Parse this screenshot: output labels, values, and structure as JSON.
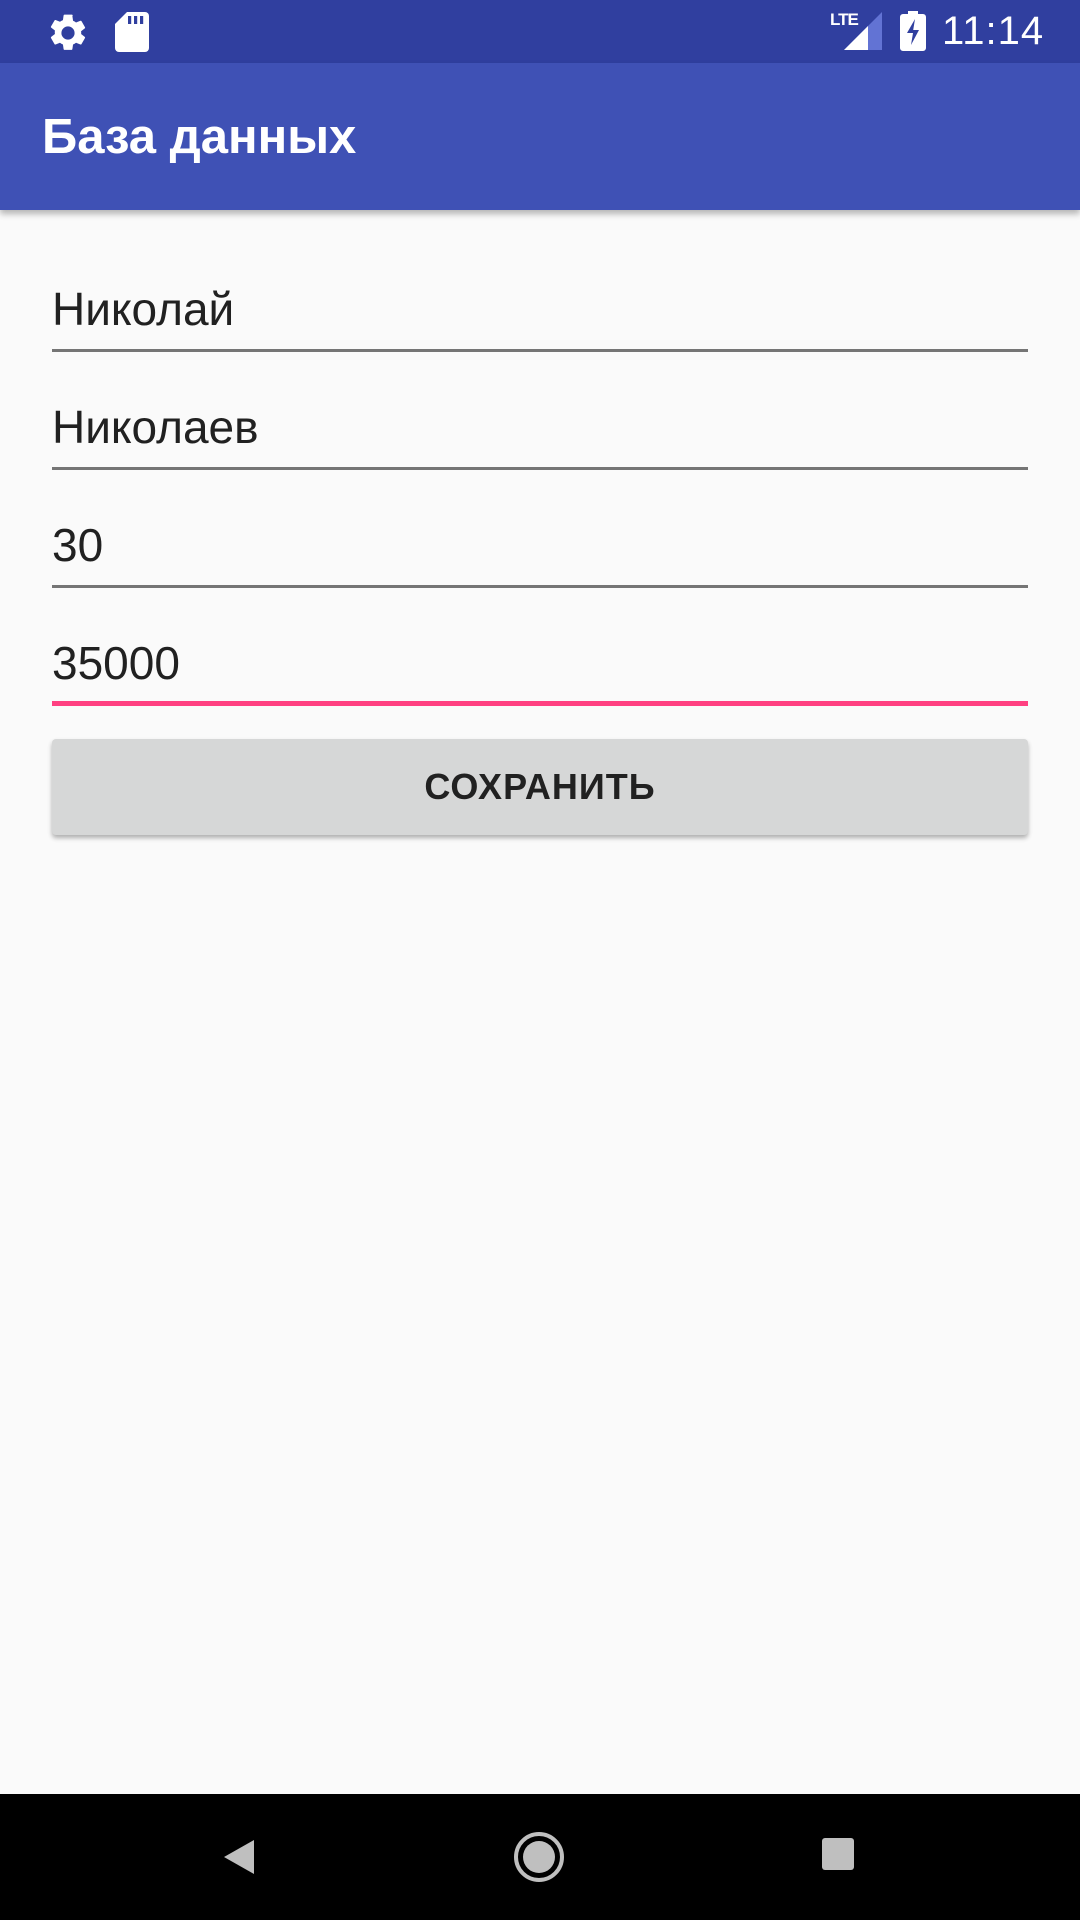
{
  "status_bar": {
    "time": "11:14",
    "network_label": "LTE",
    "icons": [
      "gear-icon",
      "sd-card-icon",
      "signal-icon",
      "battery-charging-icon"
    ]
  },
  "app_bar": {
    "title": "База данных"
  },
  "form": {
    "first_name": "Николай",
    "last_name": "Николаев",
    "age": "30",
    "salary": "35000"
  },
  "save_button": {
    "label": "СОХРАНИТЬ"
  },
  "colors": {
    "status_bar": "#303F9F",
    "app_bar": "#3F51B5",
    "focus_accent": "#FF4081",
    "background": "#FAFAFA",
    "button": "#D6D7D7"
  },
  "nav_bar": {
    "icons": [
      "back-icon",
      "home-icon",
      "recents-icon"
    ]
  }
}
